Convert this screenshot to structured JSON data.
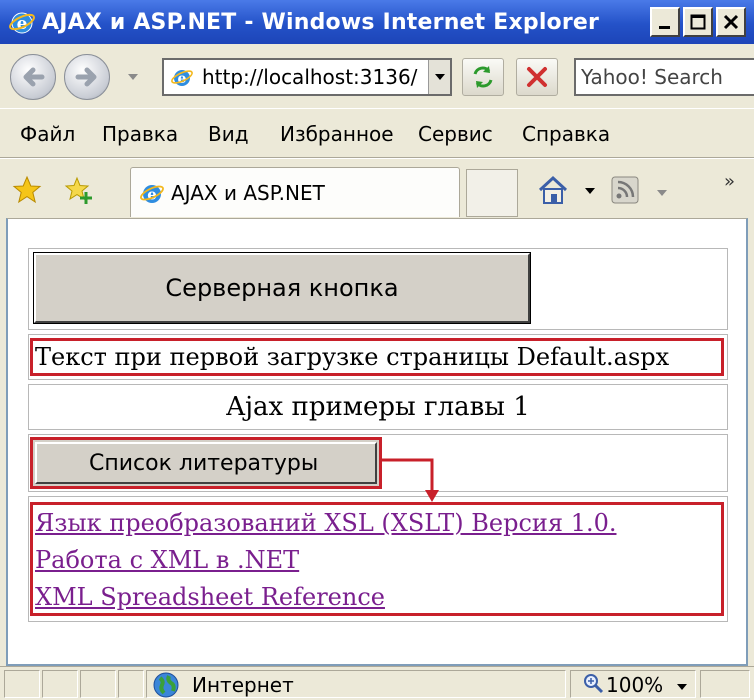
{
  "window": {
    "title": "AJAX и ASP.NET - Windows Internet Explorer"
  },
  "address_bar": {
    "url": "http://localhost:3136/",
    "search_placeholder": "Yahoo! Search"
  },
  "menu": {
    "items": [
      "Файл",
      "Правка",
      "Вид",
      "Избранное",
      "Сервис",
      "Справка"
    ]
  },
  "tab": {
    "title": "AJAX и ASP.NET"
  },
  "content": {
    "server_button_label": "Серверная кнопка",
    "first_load_text": "Текст при первой загрузке страницы Default.aspx",
    "chapter_text": "Ajax примеры главы 1",
    "literature_button_label": "Список литературы",
    "links": [
      "Язык преобразований XSL (XSLT) Версия 1.0.",
      "Работа с XML в .NET",
      "XML Spreadsheet Reference"
    ]
  },
  "status_bar": {
    "zone": "Интернет",
    "zoom": "100%"
  },
  "colors": {
    "highlight_red": "#c8202a",
    "visited_link": "#7a1f8e",
    "titlebar_blue": "#2452c8"
  }
}
